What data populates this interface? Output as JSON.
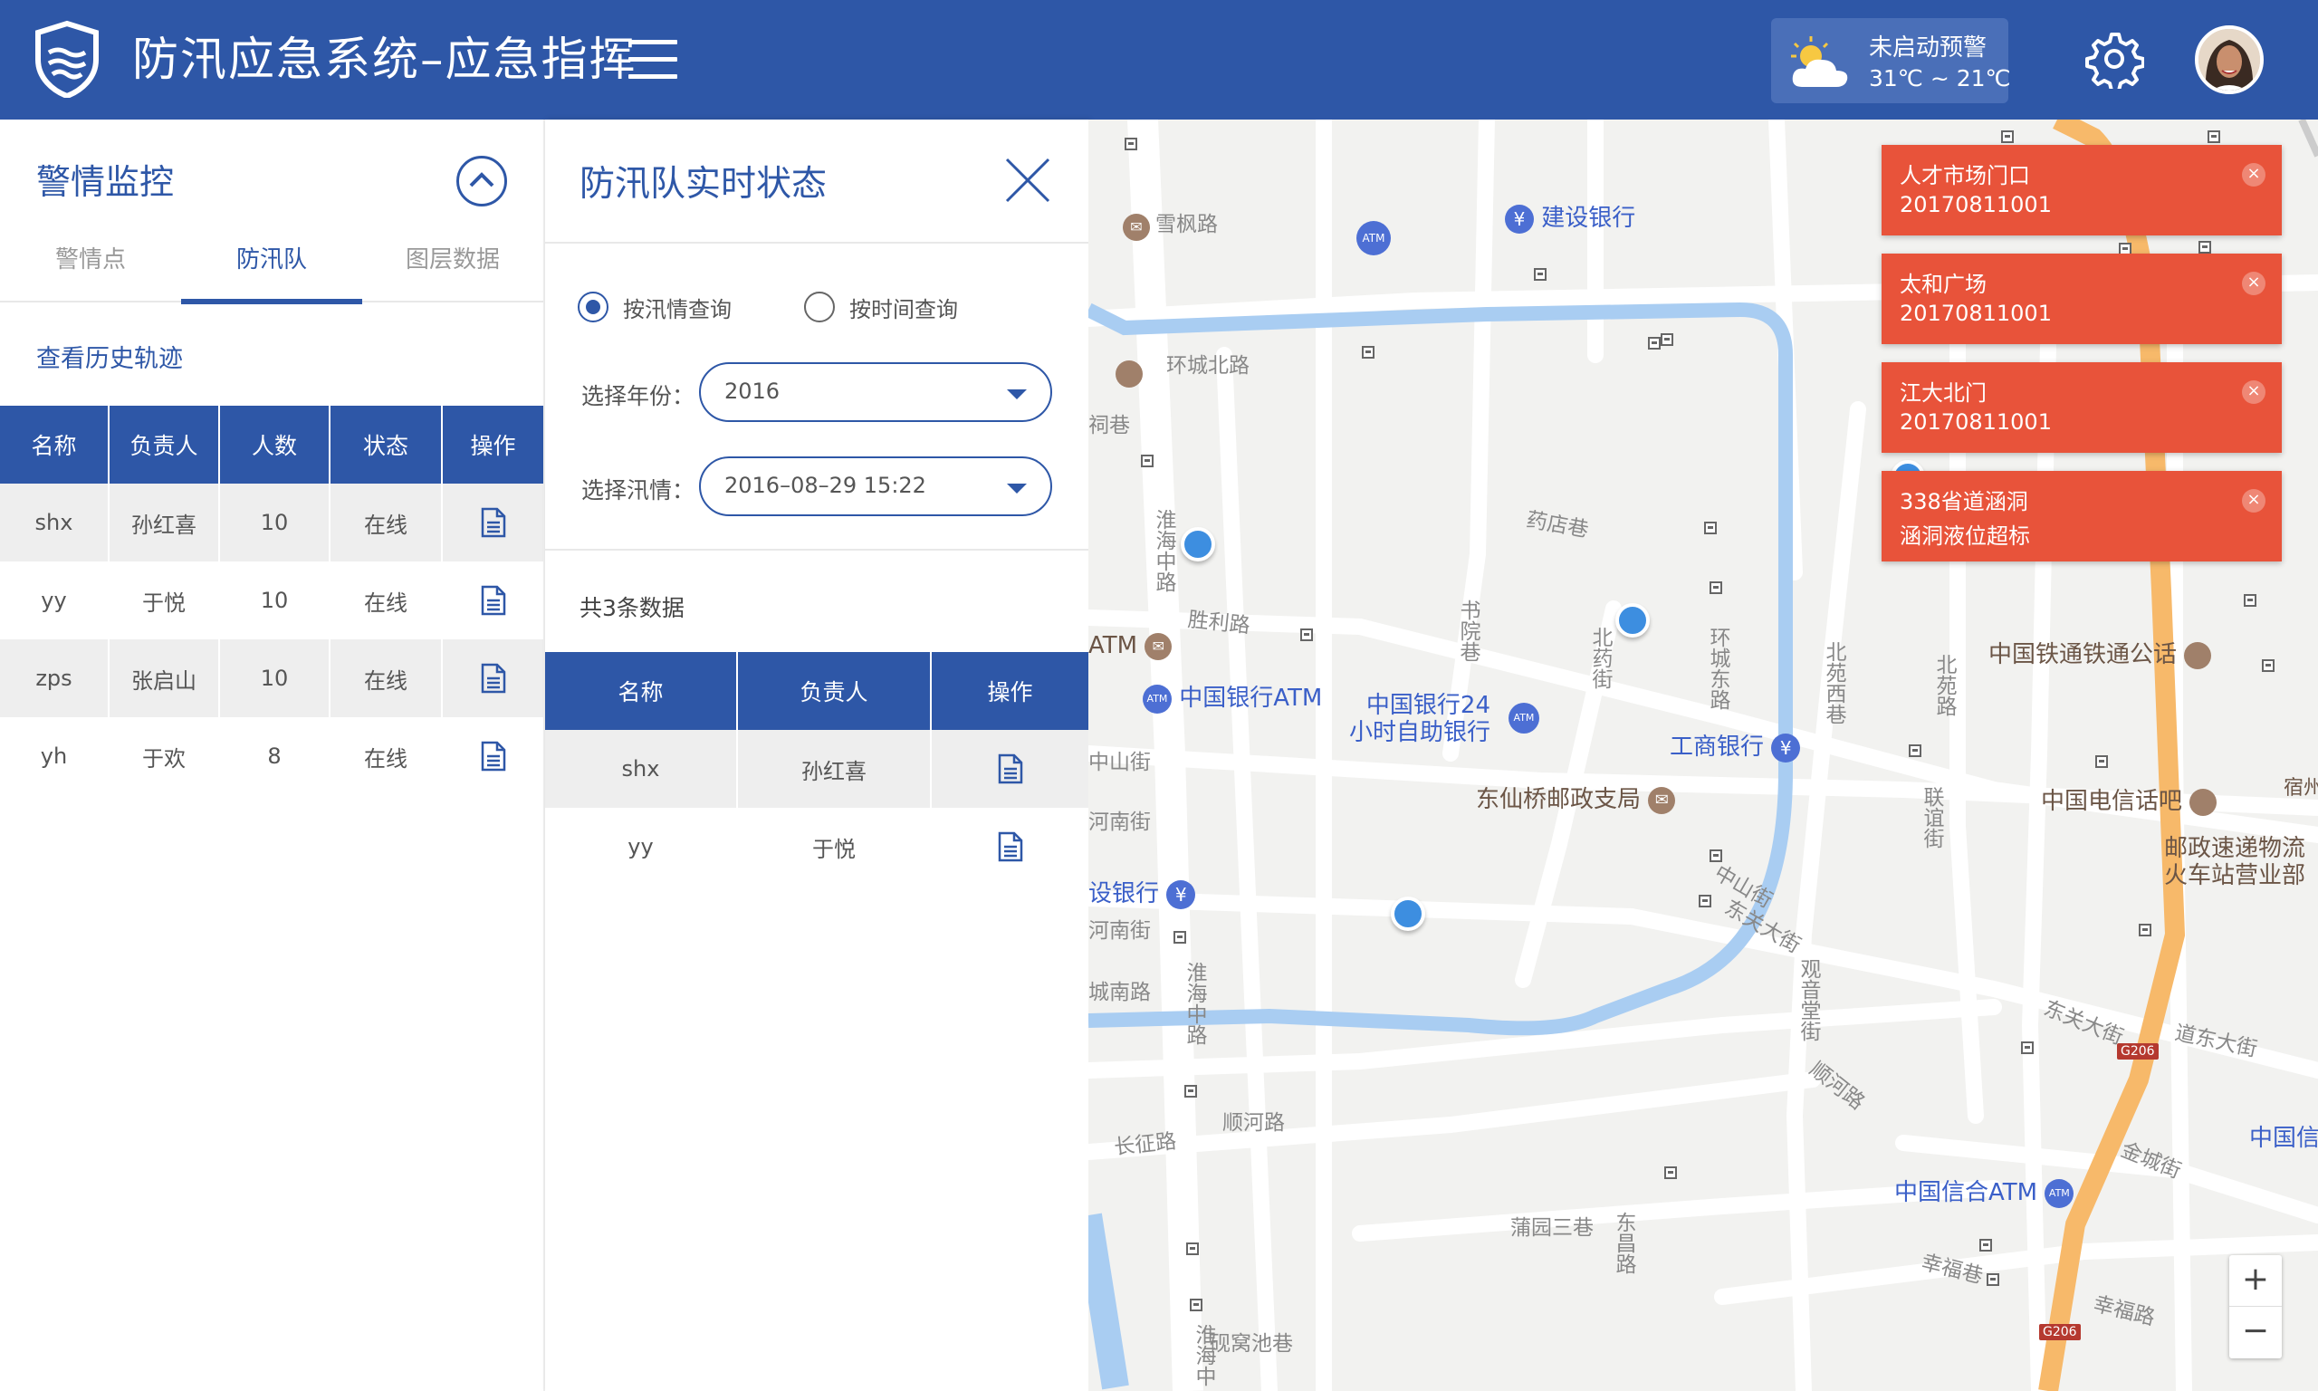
{
  "header": {
    "title": "防汛应急系统–应急指挥",
    "menu_icon": "hamburger-icon",
    "weather": {
      "status": "未启动预警",
      "temp": "31℃ ~ 21℃",
      "icon": "partly-cloudy-icon"
    },
    "settings_icon": "gear-icon",
    "avatar_icon": "user-avatar"
  },
  "colors": {
    "primary": "#2e57a7",
    "alert": "#e8533a",
    "marker": "#3d8ee0",
    "river": "#a9cdf2",
    "highway": "#f7b96a"
  },
  "left_panel": {
    "title": "警情监控",
    "tabs": [
      {
        "label": "警情点"
      },
      {
        "label": "防汛队"
      },
      {
        "label": "图层数据"
      }
    ],
    "active_tab": "防汛队",
    "history_link": "查看历史轨迹",
    "table": {
      "headers": [
        "名称",
        "负责人",
        "人数",
        "状态",
        "操作"
      ],
      "rows": [
        {
          "name": "shx",
          "leader": "孙红喜",
          "count": "10",
          "status": "在线"
        },
        {
          "name": "yy",
          "leader": "于悦",
          "count": "10",
          "status": "在线"
        },
        {
          "name": "zps",
          "leader": "张启山",
          "count": "10",
          "status": "在线"
        },
        {
          "name": "yh",
          "leader": "于欢",
          "count": "8",
          "status": "在线"
        }
      ]
    }
  },
  "mid_panel": {
    "title": "防汛队实时状态",
    "radio": [
      {
        "label": "按汛情查询",
        "checked": true
      },
      {
        "label": "按时间查询",
        "checked": false
      }
    ],
    "year_label": "选择年份：",
    "year_value": "2016",
    "flood_label": "选择汛情：",
    "flood_value": "2016–08–29 15:22",
    "count_text": "共3条数据",
    "table": {
      "headers": [
        "名称",
        "负责人",
        "操作"
      ],
      "rows": [
        {
          "name": "shx",
          "leader": "孙红喜"
        },
        {
          "name": "yy",
          "leader": "于悦"
        }
      ]
    }
  },
  "map": {
    "pois": {
      "ccb": "建设银行",
      "boc_atm": "中国银行ATM",
      "boc_24h_1": "中国银行24",
      "boc_24h_2": "小时自助银行",
      "icbc": "工商银行",
      "post_office": "东仙桥邮政支局",
      "railway_office": "中国铁通铁通公话",
      "telecom": "中国电信话吧",
      "ems_1": "邮政速递物流",
      "ems_2": "火车站营业部",
      "cib_atm": "中国信合ATM",
      "bank_left": "设银行",
      "atm_left": "ATM",
      "bank_right": "中国信",
      "suzhou": "宿州"
    },
    "streets": {
      "xuefeng": "雪枫路",
      "huancheng_n": "环城北路",
      "shengli": "胜利路",
      "zhongshan": "中山街",
      "henan1": "河南街",
      "henan2": "河南街",
      "chengnan": "城南路",
      "changzheng": "长征路",
      "shunhe": "顺河路",
      "shunhe2": "顺河路",
      "dongguan": "东关大街",
      "dongguan2": "东关大街",
      "daodong": "道东大街",
      "jincheng": "金城街",
      "xingfu": "幸福巷",
      "xingfu2": "幸福路",
      "yaodian": "药店巷",
      "puyuan": "蒲园三巷",
      "yanwochi": "砚窝池巷",
      "zhongshan2": "中山街",
      "citang": "祠巷",
      "huaihai_zhong": "淮海中路",
      "huaihai_zhong2": "淮海中路",
      "huaihai_zhong3": "淮海中",
      "shuyuan": "书院巷",
      "beiyaojie": "北药街",
      "huancheng_dong": "环城东路",
      "beiyuan_xi": "北苑西巷",
      "beiyuan": "北苑路",
      "lianhe": "联谊街",
      "guanyin": "观音堂街",
      "dongchang": "东昌路"
    },
    "highway_labels": [
      "G206",
      "G206"
    ],
    "zoom_in": "+",
    "zoom_out": "−"
  },
  "alerts": [
    {
      "title": "人才市场门口",
      "detail": "20170811001"
    },
    {
      "title": "太和广场",
      "detail": "20170811001"
    },
    {
      "title": "江大北门",
      "detail": "20170811001"
    },
    {
      "title": "338省道涵洞",
      "detail": "涵洞液位超标"
    }
  ]
}
